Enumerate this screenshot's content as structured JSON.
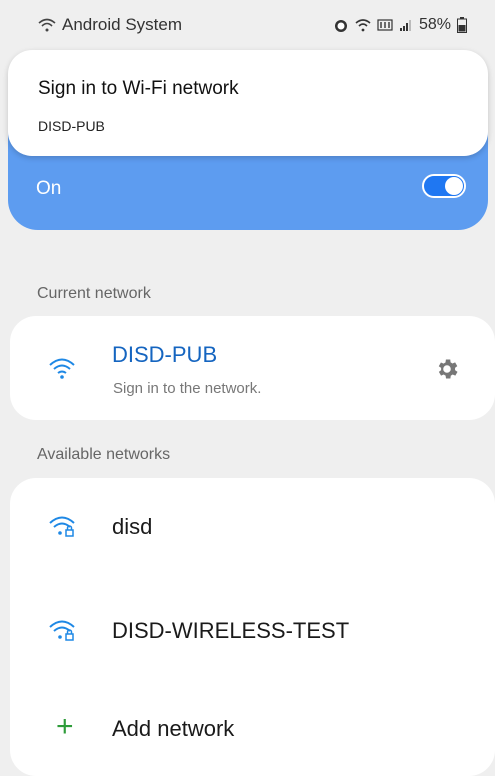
{
  "status_bar": {
    "app_name": "Android System",
    "battery": "58%"
  },
  "notification": {
    "title": "Sign in to Wi-Fi network",
    "network": "DISD-PUB"
  },
  "wifi_toggle": {
    "label": "On",
    "state": "on"
  },
  "current_network": {
    "section_label": "Current network",
    "name": "DISD-PUB",
    "status": "Sign in to the network."
  },
  "available_networks": {
    "section_label": "Available networks",
    "items": [
      {
        "name": "disd",
        "icon": "wifi-lock-icon"
      },
      {
        "name": "DISD-WIRELESS-TEST",
        "icon": "wifi-lock-icon"
      }
    ],
    "add_label": "Add network"
  },
  "colors": {
    "accent": "#5d9cf0",
    "toggle": "#1f77f2",
    "current_network_text": "#1565c0",
    "add_icon": "#2e9c3a"
  }
}
